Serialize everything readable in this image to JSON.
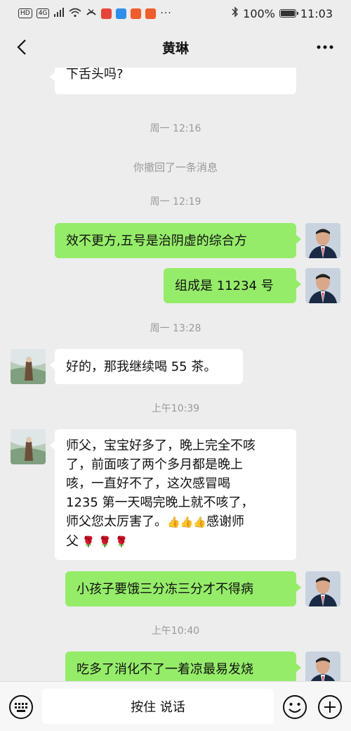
{
  "status_bar": {
    "left_badges": [
      "HD",
      "4G"
    ],
    "battery": "100%",
    "time": "11:03"
  },
  "header": {
    "title": "黄琳",
    "back_icon": "chevron-left-icon",
    "more_icon": "more-dots-icon"
  },
  "chat": {
    "messages": [
      {
        "type": "in_partial",
        "text": "下舌头吗?"
      },
      {
        "type": "time",
        "text": "周一 12:16"
      },
      {
        "type": "system",
        "text": "你撤回了一条消息"
      },
      {
        "type": "time",
        "text": "周一 12:19"
      },
      {
        "type": "out",
        "text": "效不更方,五号是治阴虚的综合方"
      },
      {
        "type": "out",
        "text": "组成是 11234 号"
      },
      {
        "type": "time",
        "text": "周一 13:28"
      },
      {
        "type": "in",
        "text": "好的，那我继续喝 55 茶。"
      },
      {
        "type": "time",
        "text": "上午10:39"
      },
      {
        "type": "in",
        "lines": [
          "师父，宝宝好多了，晚上完全不咳",
          "了，前面咳了两个多月都是晚上",
          "咳，一直好不了，这次感冒喝",
          "1235 第一天喝完晚上就不咳了，"
        ],
        "line5": "师父您太厉害了。",
        "line5b": "感谢师",
        "line6": "父"
      },
      {
        "type": "out",
        "text": "小孩子要饿三分冻三分才不得病"
      },
      {
        "type": "time",
        "text": "上午10:40"
      },
      {
        "type": "out",
        "text": "吃多了消化不了一着凉最易发烧"
      }
    ]
  },
  "bottom_bar": {
    "talk_label": "按住 说话",
    "keyboard_icon": "keyboard-icon",
    "emoji_icon": "emoji-icon",
    "plus_icon": "plus-circle-icon"
  }
}
